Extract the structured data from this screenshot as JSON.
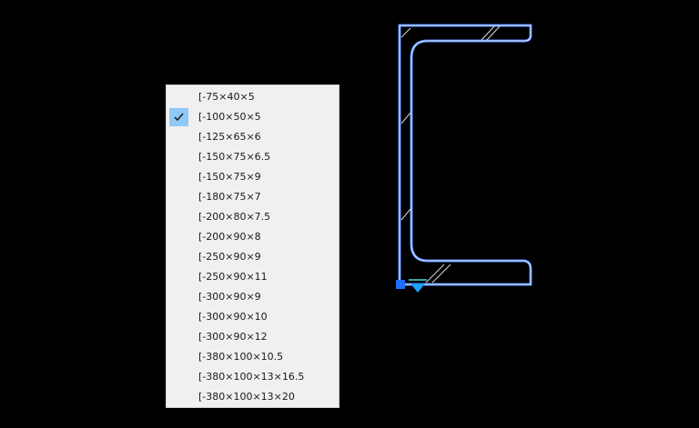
{
  "colors": {
    "background": "#000000",
    "profile_stroke": "#4d86ff",
    "profile_inner": "#e8eeff",
    "hatch": "#d8d8d8",
    "grip": "#1e6dff",
    "marker": "#1fa2ff",
    "menu_background": "#f0f0f0",
    "check_highlight": "#90c8f6"
  },
  "canvas": {
    "grip_icon": "square-grip-icon",
    "marker_icon": "triangle-marker-icon"
  },
  "menu": {
    "checked_index": 1,
    "check_icon": "checkmark-icon",
    "items": [
      {
        "label": "[-75×40×5"
      },
      {
        "label": "[-100×50×5"
      },
      {
        "label": "[-125×65×6"
      },
      {
        "label": "[-150×75×6.5"
      },
      {
        "label": "[-150×75×9"
      },
      {
        "label": "[-180×75×7"
      },
      {
        "label": "[-200×80×7.5"
      },
      {
        "label": "[-200×90×8"
      },
      {
        "label": "[-250×90×9"
      },
      {
        "label": "[-250×90×11"
      },
      {
        "label": "[-300×90×9"
      },
      {
        "label": "[-300×90×10"
      },
      {
        "label": "[-300×90×12"
      },
      {
        "label": "[-380×100×10.5"
      },
      {
        "label": "[-380×100×13×16.5"
      },
      {
        "label": "[-380×100×13×20"
      }
    ]
  }
}
